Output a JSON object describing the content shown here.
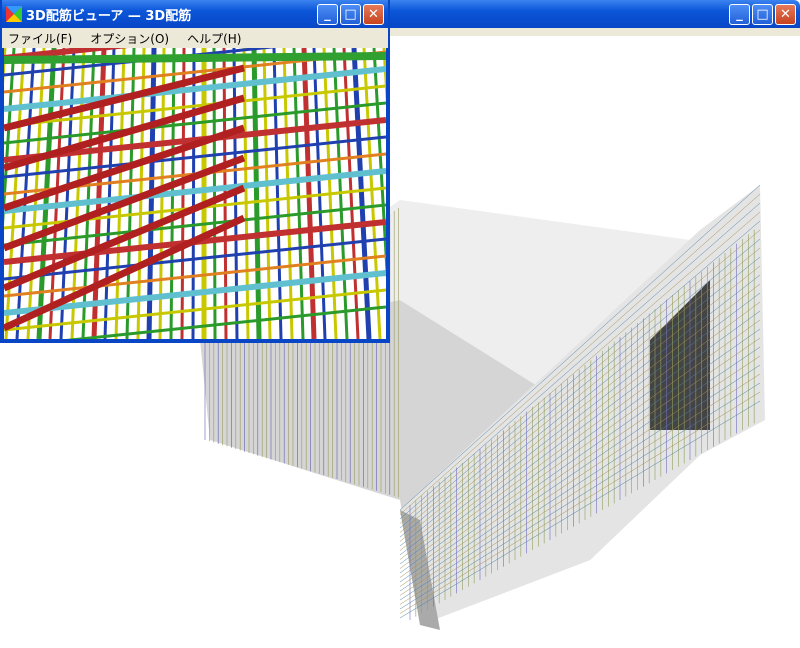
{
  "back_window": {
    "title": "",
    "controls": [
      "minimize",
      "maximize",
      "close"
    ]
  },
  "front_window": {
    "title": "3D配筋ビューア — 3D配筋",
    "menu": [
      "ファイル(F)",
      "オプション(O)",
      "ヘルプ(H)"
    ],
    "controls": [
      "minimize",
      "maximize",
      "close"
    ]
  },
  "colors": {
    "titlebar": "#0a55d8",
    "menubar": "#ece9d8",
    "close": "#c8431e"
  }
}
